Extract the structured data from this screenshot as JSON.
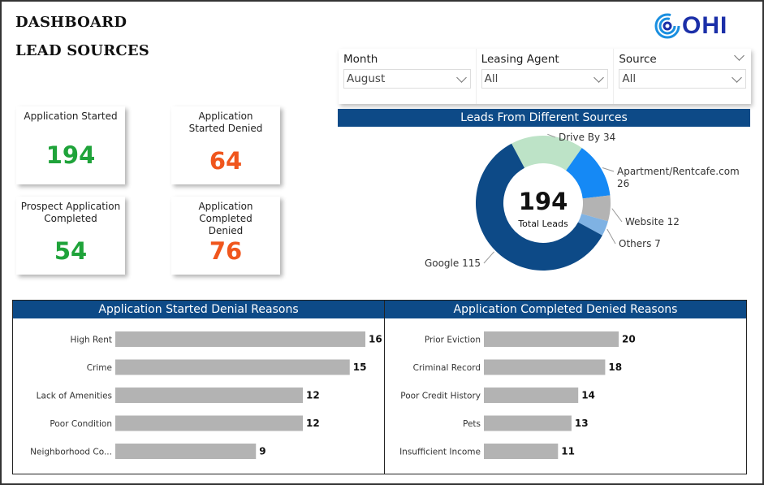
{
  "header": {
    "title": "DASHBOARD",
    "subtitle": "LEAD SOURCES",
    "logo_text": "OHI"
  },
  "colors": {
    "header_blue": "#0d4a87",
    "positive_green": "#1fa33a",
    "negative_orange": "#f0561d",
    "bar_gray": "#b3b3b3",
    "logo_blue": "#1b2fa8"
  },
  "filters": [
    {
      "label": "Month",
      "value": "August"
    },
    {
      "label": "Leasing Agent",
      "value": "All"
    },
    {
      "label": "Source",
      "value": "All"
    }
  ],
  "kpis": [
    {
      "label": "Application Started",
      "value": "194",
      "tone": "positive"
    },
    {
      "label": "Application Started Denied",
      "value": "64",
      "tone": "negative"
    },
    {
      "label": "Prospect Application Completed",
      "value": "54",
      "tone": "positive"
    },
    {
      "label": "Application Completed Denied",
      "value": "76",
      "tone": "negative"
    }
  ],
  "chart_data": [
    {
      "type": "pie",
      "title": "Leads From Different Sources",
      "center_value": "194",
      "center_label": "Total Leads",
      "slices": [
        {
          "label": "Drive By",
          "value": 34,
          "color": "#bde3c7"
        },
        {
          "label": "Apartment/Rentcafe.com",
          "value": 26,
          "color": "#1589f5"
        },
        {
          "label": "Website",
          "value": 12,
          "color": "#b3b3b3"
        },
        {
          "label": "Others",
          "value": 7,
          "color": "#7fb2e3"
        },
        {
          "label": "Google",
          "value": 115,
          "color": "#0d4a87"
        }
      ]
    },
    {
      "type": "bar",
      "orientation": "horizontal",
      "title": "Application Started Denial Reasons",
      "categories": [
        "High Rent",
        "Crime",
        "Lack of Amenities",
        "Poor Condition",
        "Neighborhood Co..."
      ],
      "values": [
        16,
        15,
        12,
        12,
        9
      ],
      "xlim": [
        0,
        16
      ]
    },
    {
      "type": "bar",
      "orientation": "horizontal",
      "title": "Application Completed Denied Reasons",
      "categories": [
        "Prior Eviction",
        "Criminal Record",
        "Poor Credit History",
        "Pets",
        "Insufficient Income"
      ],
      "values": [
        20,
        18,
        14,
        13,
        11
      ],
      "xlim": [
        0,
        40
      ]
    }
  ]
}
